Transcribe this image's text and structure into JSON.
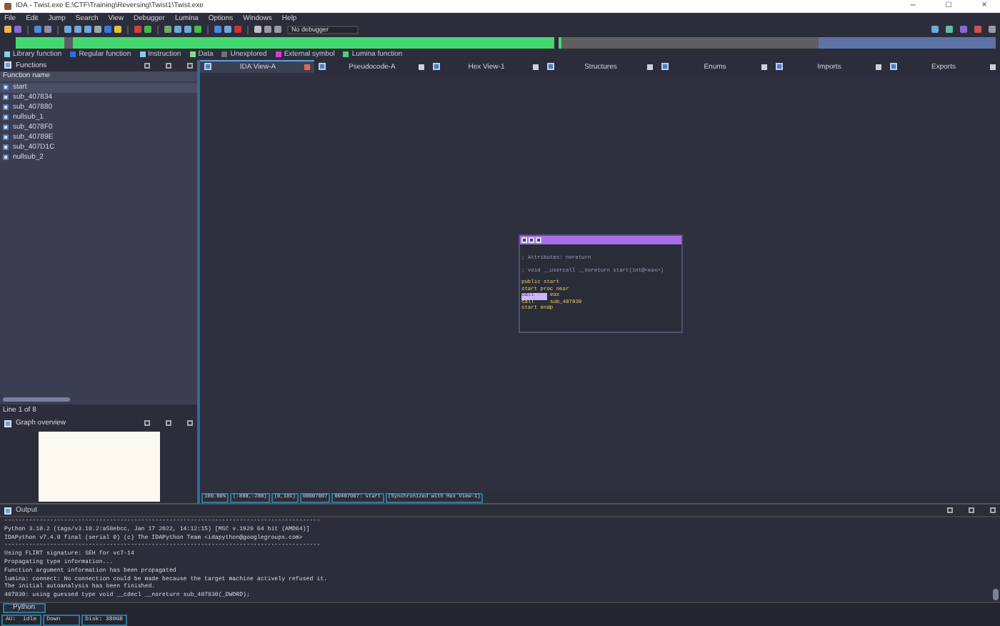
{
  "window": {
    "title": "IDA - Twist.exe E:\\CTF\\Training\\Reversing\\Twist1\\Twist.exe",
    "controls": [
      "–",
      "□",
      "×"
    ]
  },
  "menu": [
    "File",
    "Edit",
    "Jump",
    "Search",
    "View",
    "Debugger",
    "Lumina",
    "Options",
    "Windows",
    "Help"
  ],
  "toolbar": {
    "debugger": "No debugger"
  },
  "legend": [
    {
      "label": "Library function",
      "color": "#7fd4ea"
    },
    {
      "label": "Regular function",
      "color": "#2a6fdb"
    },
    {
      "label": "Instruction",
      "color": "#8ccbe0"
    },
    {
      "label": "Data",
      "color": "#7fe08a"
    },
    {
      "label": "Unexplored",
      "color": "#6f6f6f"
    },
    {
      "label": "External symbol",
      "color": "#d63cd6"
    },
    {
      "label": "Lumina function",
      "color": "#43d47a"
    }
  ],
  "functions_panel": {
    "title": "Functions",
    "column": "Function name",
    "status": "Line 1 of 8",
    "items": [
      {
        "name": "start",
        "selected": true
      },
      {
        "name": "sub_407834",
        "selected": false
      },
      {
        "name": "sub_407880",
        "selected": false
      },
      {
        "name": "nullsub_1",
        "selected": false
      },
      {
        "name": "sub_4078F0",
        "selected": false
      },
      {
        "name": "sub_40789E",
        "selected": false
      },
      {
        "name": "sub_407D1C",
        "selected": false
      },
      {
        "name": "nullsub_2",
        "selected": false
      }
    ]
  },
  "graph_overview": {
    "title": "Graph overview"
  },
  "tabs": [
    {
      "label": "IDA View-A",
      "selected": true
    },
    {
      "label": "Pseudocode-A",
      "selected": false
    },
    {
      "label": "Hex View-1",
      "selected": false
    },
    {
      "label": "Structures",
      "selected": false
    },
    {
      "label": "Enums",
      "selected": false
    },
    {
      "label": "Imports",
      "selected": false
    },
    {
      "label": "Exports",
      "selected": false
    }
  ],
  "graph_node": {
    "lines": [
      {
        "kind": "comment",
        "text": "; Attributes: noreturn"
      },
      {
        "kind": "comment",
        "text": "; void __usercall __noreturn start(int@<eax>)"
      },
      {
        "kind": "label",
        "text": "public start"
      },
      {
        "kind": "label",
        "text": "start proc near"
      },
      {
        "kind": "code",
        "mnemonic": "call",
        "operand": "eax",
        "selected": true
      },
      {
        "kind": "code",
        "mnemonic": "call",
        "operand": "sub_407830",
        "selected": false
      },
      {
        "kind": "label",
        "text": "start endp"
      }
    ]
  },
  "status_line": [
    "100.00%",
    "(-888,-288)",
    "(0,181)",
    "00007007",
    "00407007: start",
    "(Synchronized with Hex View-1)"
  ],
  "output": {
    "title": "Output",
    "tab": "Python",
    "lines": [
      "------------------------------------------------------------------------------------------",
      "Python 3.10.2 (tags/v3.10.2:a58ebcc, Jan 17 2022, 14:12:15) [MSC v.1929 64 bit (AMD64)]",
      "IDAPython v7.4.0 final (serial 0) (c) The IDAPython Team <idapython@googlegroups.com>",
      "------------------------------------------------------------------------------------------",
      "Using FLIRT signature: SEH for vc7-14",
      "Propagating type information...",
      "Function argument information has been propagated",
      "lumina: connect: No connection could be made because the target machine actively refused it.",
      "The initial autoanalysis has been finished.",
      "407830: using guessed type void __cdecl __noreturn sub_407830(_DWORD);"
    ]
  },
  "status_bar": [
    "AU:  idle",
    "Down",
    "Disk: 380GB"
  ]
}
